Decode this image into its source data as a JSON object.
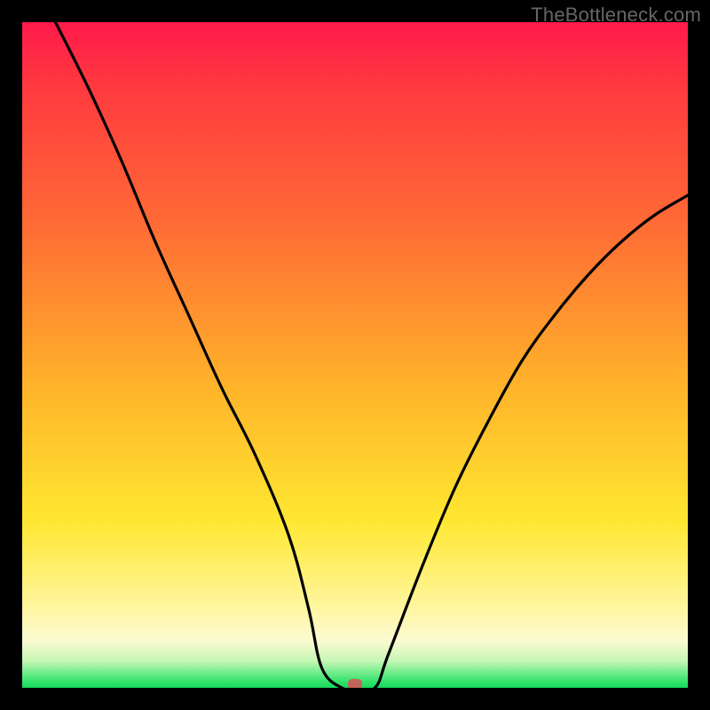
{
  "watermark": "TheBottleneck.com",
  "chart_data": {
    "type": "line",
    "title": "",
    "xlabel": "",
    "ylabel": "",
    "xlim": [
      0,
      100
    ],
    "ylim": [
      0,
      100
    ],
    "x": [
      5,
      10,
      15,
      20,
      25,
      30,
      35,
      40,
      43,
      45,
      48,
      50,
      53,
      55,
      60,
      65,
      70,
      75,
      80,
      85,
      90,
      95,
      100
    ],
    "y": [
      100,
      90,
      79,
      67,
      56,
      45,
      35,
      23,
      12,
      3,
      0,
      0,
      0,
      5,
      18,
      30,
      40,
      49,
      56,
      62,
      67,
      71,
      74
    ],
    "marker": {
      "x": 50,
      "y": 0
    },
    "grid": false,
    "legend": false
  },
  "colors": {
    "curve": "#000000",
    "marker": "#c1645a",
    "frame": "#000000"
  }
}
